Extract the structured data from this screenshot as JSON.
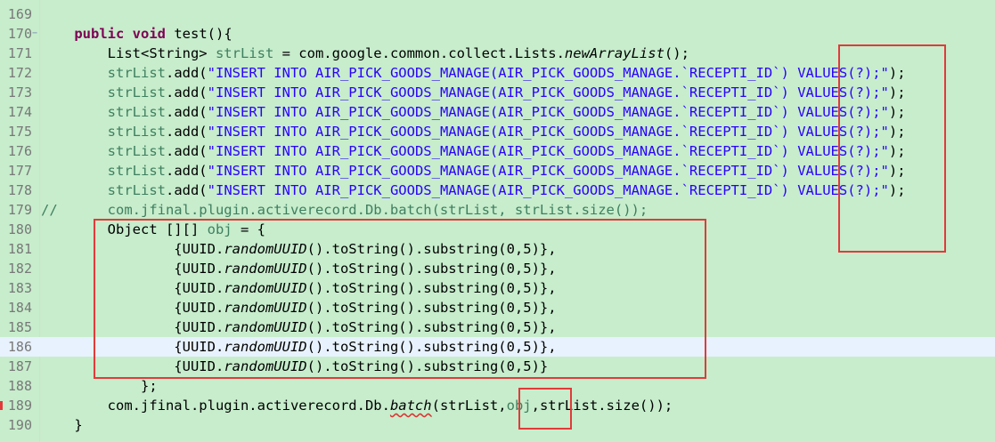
{
  "editor": {
    "current_line": "186",
    "lines": [
      {
        "num": "169",
        "segments": []
      },
      {
        "num": "170",
        "fold": true,
        "segments": [
          {
            "t": "    "
          },
          {
            "t": "public",
            "c": "kw"
          },
          {
            "t": " "
          },
          {
            "t": "void",
            "c": "kw"
          },
          {
            "t": " test(){"
          }
        ]
      },
      {
        "num": "171",
        "segments": [
          {
            "t": "        List<String> "
          },
          {
            "t": "strList",
            "c": "cmt"
          },
          {
            "t": " = com.google.common.collect.Lists."
          },
          {
            "t": "newArrayList",
            "c": "it"
          },
          {
            "t": "();"
          }
        ]
      },
      {
        "num": "172",
        "segments": [
          {
            "t": "        "
          },
          {
            "t": "strList",
            "c": "cmt"
          },
          {
            "t": ".add("
          },
          {
            "t": "\"INSERT INTO AIR_PICK_GOODS_MANAGE(AIR_PICK_GOODS_MANAGE.`RECEPTI_ID`) VALUES(?);\"",
            "c": "str"
          },
          {
            "t": ");"
          }
        ]
      },
      {
        "num": "173",
        "segments": [
          {
            "t": "        "
          },
          {
            "t": "strList",
            "c": "cmt"
          },
          {
            "t": ".add("
          },
          {
            "t": "\"INSERT INTO AIR_PICK_GOODS_MANAGE(AIR_PICK_GOODS_MANAGE.`RECEPTI_ID`) VALUES(?);\"",
            "c": "str"
          },
          {
            "t": ");"
          }
        ]
      },
      {
        "num": "174",
        "segments": [
          {
            "t": "        "
          },
          {
            "t": "strList",
            "c": "cmt"
          },
          {
            "t": ".add("
          },
          {
            "t": "\"INSERT INTO AIR_PICK_GOODS_MANAGE(AIR_PICK_GOODS_MANAGE.`RECEPTI_ID`) VALUES(?);\"",
            "c": "str"
          },
          {
            "t": ");"
          }
        ]
      },
      {
        "num": "175",
        "segments": [
          {
            "t": "        "
          },
          {
            "t": "strList",
            "c": "cmt"
          },
          {
            "t": ".add("
          },
          {
            "t": "\"INSERT INTO AIR_PICK_GOODS_MANAGE(AIR_PICK_GOODS_MANAGE.`RECEPTI_ID`) VALUES(?);\"",
            "c": "str"
          },
          {
            "t": ");"
          }
        ]
      },
      {
        "num": "176",
        "segments": [
          {
            "t": "        "
          },
          {
            "t": "strList",
            "c": "cmt"
          },
          {
            "t": ".add("
          },
          {
            "t": "\"INSERT INTO AIR_PICK_GOODS_MANAGE(AIR_PICK_GOODS_MANAGE.`RECEPTI_ID`) VALUES(?);\"",
            "c": "str"
          },
          {
            "t": ");"
          }
        ]
      },
      {
        "num": "177",
        "segments": [
          {
            "t": "        "
          },
          {
            "t": "strList",
            "c": "cmt"
          },
          {
            "t": ".add("
          },
          {
            "t": "\"INSERT INTO AIR_PICK_GOODS_MANAGE(AIR_PICK_GOODS_MANAGE.`RECEPTI_ID`) VALUES(?);\"",
            "c": "str"
          },
          {
            "t": ");"
          }
        ]
      },
      {
        "num": "178",
        "segments": [
          {
            "t": "        "
          },
          {
            "t": "strList",
            "c": "cmt"
          },
          {
            "t": ".add("
          },
          {
            "t": "\"INSERT INTO AIR_PICK_GOODS_MANAGE(AIR_PICK_GOODS_MANAGE.`RECEPTI_ID`) VALUES(?);\"",
            "c": "str"
          },
          {
            "t": ");"
          }
        ]
      },
      {
        "num": "179",
        "segments": [
          {
            "t": "//      com.jfinal.plugin.activerecord.Db.batch(strList, strList.size());",
            "c": "cmt"
          }
        ]
      },
      {
        "num": "180",
        "segments": [
          {
            "t": "        Object [][] "
          },
          {
            "t": "obj",
            "c": "cmt"
          },
          {
            "t": " = {"
          }
        ]
      },
      {
        "num": "181",
        "segments": [
          {
            "t": "                {UUID."
          },
          {
            "t": "randomUUID",
            "c": "it"
          },
          {
            "t": "().toString().substring(0,5)},"
          }
        ]
      },
      {
        "num": "182",
        "segments": [
          {
            "t": "                {UUID."
          },
          {
            "t": "randomUUID",
            "c": "it"
          },
          {
            "t": "().toString().substring(0,5)},"
          }
        ]
      },
      {
        "num": "183",
        "segments": [
          {
            "t": "                {UUID."
          },
          {
            "t": "randomUUID",
            "c": "it"
          },
          {
            "t": "().toString().substring(0,5)},"
          }
        ]
      },
      {
        "num": "184",
        "segments": [
          {
            "t": "                {UUID."
          },
          {
            "t": "randomUUID",
            "c": "it"
          },
          {
            "t": "().toString().substring(0,5)},"
          }
        ]
      },
      {
        "num": "185",
        "segments": [
          {
            "t": "                {UUID."
          },
          {
            "t": "randomUUID",
            "c": "it"
          },
          {
            "t": "().toString().substring(0,5)},"
          }
        ]
      },
      {
        "num": "186",
        "segments": [
          {
            "t": "                {UUID."
          },
          {
            "t": "randomUUID",
            "c": "it"
          },
          {
            "t": "().toString().substring(0,5)},"
          }
        ]
      },
      {
        "num": "187",
        "segments": [
          {
            "t": "                {UUID."
          },
          {
            "t": "randomUUID",
            "c": "it"
          },
          {
            "t": "().toString().substring(0,5)}"
          }
        ]
      },
      {
        "num": "188",
        "segments": [
          {
            "t": "            };"
          }
        ]
      },
      {
        "num": "189",
        "error": true,
        "segments": [
          {
            "t": "        com.jfinal.plugin.activerecord.Db."
          },
          {
            "t": "batch",
            "c": "it err"
          },
          {
            "t": "(strList,"
          },
          {
            "t": "obj",
            "c": "cmt"
          },
          {
            "t": ",strList.size());"
          }
        ]
      },
      {
        "num": "190",
        "segments": [
          {
            "t": "    }"
          }
        ]
      }
    ]
  },
  "colors": {
    "background": "#c7edcc",
    "current_line": "#e8f2fe",
    "keyword": "#7f0055",
    "string": "#2a00ff",
    "comment": "#3f7f5f",
    "annotation_box": "#e23a3a"
  }
}
